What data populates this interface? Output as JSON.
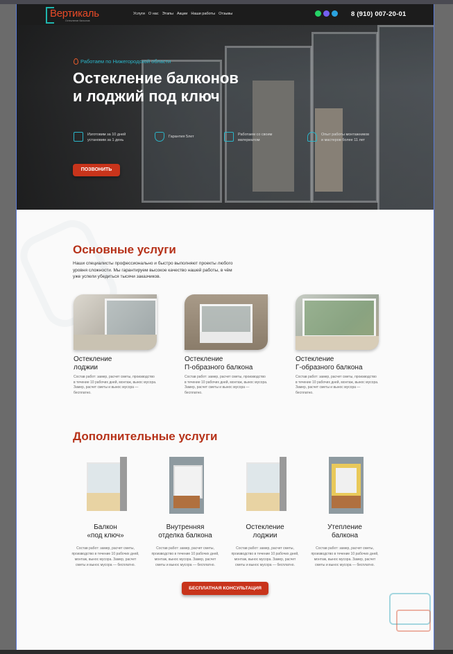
{
  "header": {
    "logo_name": "Вертикаль",
    "logo_tagline": "Остекление балконов",
    "menu": [
      "Услуги",
      "О нас",
      "Этапы",
      "Акции",
      "Наши работы",
      "Отзывы"
    ],
    "phone": "8 (910) 007-20-01",
    "messenger_colors": [
      "#25d366",
      "#7360f2",
      "#2aa3e0"
    ]
  },
  "hero": {
    "region": "Работаем по Нижегородской области",
    "title_line1": "Остекление балконов",
    "title_line2": "и лоджий под ключ",
    "features": [
      {
        "icon": "window-icon",
        "line1": "Изготовим за 10 дней",
        "line2": "установим за 1 день"
      },
      {
        "icon": "shield-icon",
        "line1": "Гарантия 5лет",
        "line2": ""
      },
      {
        "icon": "thumbs-up-icon",
        "line1": "Работаем со своим",
        "line2": "материалом"
      },
      {
        "icon": "worker-icon",
        "line1": "Опыт работы монтажников",
        "line2": "и мастеров более 11 лет"
      }
    ],
    "cta": "ПОЗВОНИТЬ"
  },
  "services": {
    "title": "Основные услуги",
    "intro": "Наши специалисты профессионально и быстро выполняют проекты любого уровня сложности. Мы гарантируем высокое качество нашей работы, в чём уже успели убедиться тысячи заказчиков.",
    "cards": [
      {
        "title_line1": "Остекление",
        "title_line2": "лоджии",
        "desc": "Состав работ: замер, расчет сметы, производство в течение 10 рабочих дней, монтаж, вынос мусора. Замер, расчет сметы и вынос мусора — бесплатно."
      },
      {
        "title_line1": "Остекление",
        "title_line2": "П-образного балкона",
        "desc": "Состав работ: замер, расчет сметы, производство в течение 10 рабочих дней, монтаж, вынос мусора. Замер, расчет сметы и вынос мусора — бесплатно."
      },
      {
        "title_line1": "Остекление",
        "title_line2": "Г-образного балкона",
        "desc": "Состав работ: замер, расчет сметы, производство в течение 10 рабочих дней, монтаж, вынос мусора. Замер, расчет сметы и вынос мусора — бесплатно."
      }
    ]
  },
  "additional": {
    "title": "Дополнительные услуги",
    "items": [
      {
        "title_line1": "Балкон",
        "title_line2": "«под ключ»",
        "desc": "Состав работ: замер, расчет сметы, производство в течение 10 рабочих дней, монтаж, вынос мусора. Замер, расчет сметы и вынос мусора — бесплатно."
      },
      {
        "title_line1": "Внутренняя",
        "title_line2": "отделка балкона",
        "desc": "Состав работ: замер, расчет сметы, производство в течение 10 рабочих дней, монтаж, вынос мусора. Замер, расчет сметы и вынос мусора — бесплатно."
      },
      {
        "title_line1": "Остекление",
        "title_line2": "лоджии",
        "desc": "Состав работ: замер, расчет сметы, производство в течение 10 рабочих дней, монтаж, вынос мусора. Замер, расчет сметы и вынос мусора — бесплатно."
      },
      {
        "title_line1": "Утепление",
        "title_line2": "балкона",
        "desc": "Состав работ: замер, расчет сметы, производство в течение 10 рабочих дней, монтаж, вынос мусора. Замер, расчет сметы и вынос мусора — бесплатно."
      }
    ],
    "cta": "БЕСПЛАТНАЯ КОНСУЛЬТАЦИЯ"
  },
  "colors": {
    "accent": "#b63219",
    "teal": "#2bb5c9",
    "button": "#c8341b"
  }
}
